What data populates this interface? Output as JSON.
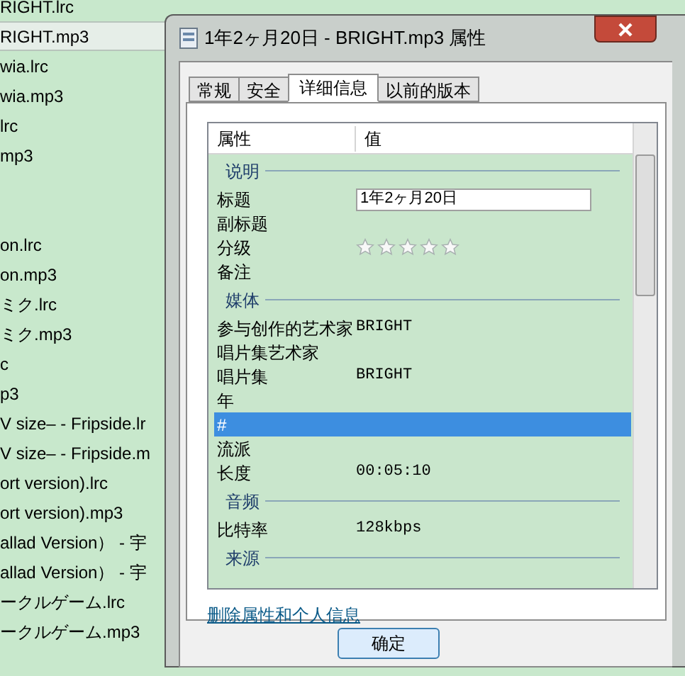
{
  "file_list": [
    {
      "name": "RIGHT.lrc",
      "selected": false
    },
    {
      "name": "RIGHT.mp3",
      "selected": true
    },
    {
      "name": "wia.lrc",
      "selected": false
    },
    {
      "name": "wia.mp3",
      "selected": false
    },
    {
      "name": "lrc",
      "selected": false
    },
    {
      "name": "mp3",
      "selected": false
    },
    {
      "selected": false
    },
    {
      "selected": false
    },
    {
      "name": "on.lrc",
      "selected": false
    },
    {
      "name": "on.mp3",
      "selected": false
    },
    {
      "name": "ミク.lrc",
      "selected": false
    },
    {
      "name": "ミク.mp3",
      "selected": false
    },
    {
      "name": "c",
      "selected": false
    },
    {
      "name": "p3",
      "selected": false
    },
    {
      "name": "V  size– - Fripside.lr",
      "selected": false
    },
    {
      "name": "V  size– - Fripside.m",
      "selected": false
    },
    {
      "name": "ort version).lrc",
      "selected": false
    },
    {
      "name": "ort version).mp3",
      "selected": false
    },
    {
      "name": "allad  Version） - 宇",
      "selected": false
    },
    {
      "name": "allad  Version） - 宇",
      "selected": false
    },
    {
      "name": "ークルゲーム.lrc",
      "selected": false
    },
    {
      "name": "ークルゲーム.mp3",
      "selected": false
    }
  ],
  "dialog": {
    "title": "1年2ヶ月20日 - BRIGHT.mp3 属性",
    "tabs": [
      {
        "label": "常规",
        "selected": false
      },
      {
        "label": "安全",
        "selected": false
      },
      {
        "label": "详细信息",
        "selected": true
      },
      {
        "label": "以前的版本",
        "selected": false
      }
    ],
    "columns": [
      "属性",
      "值"
    ],
    "groups": [
      {
        "heading": "说明",
        "rows": [
          {
            "kind": "input",
            "label": "标题",
            "value": "1年2ヶ月20日",
            "selected": false
          },
          {
            "kind": "text",
            "label": "副标题",
            "selected": false
          },
          {
            "kind": "rating",
            "label": "分级",
            "stars": 0,
            "selected": false
          },
          {
            "kind": "text",
            "label": "备注",
            "selected": false
          }
        ]
      },
      {
        "heading": "媒体",
        "rows": [
          {
            "kind": "text",
            "label": "参与创作的艺术家",
            "value": "BRIGHT",
            "selected": false
          },
          {
            "kind": "text",
            "label": "唱片集艺术家",
            "selected": false
          },
          {
            "kind": "text",
            "label": "唱片集",
            "value": "BRIGHT",
            "selected": false
          },
          {
            "kind": "text",
            "label": "年",
            "selected": false
          },
          {
            "kind": "text",
            "label": "#",
            "selected": true
          },
          {
            "kind": "text",
            "label": "流派",
            "selected": false
          },
          {
            "kind": "text",
            "label": "长度",
            "value": "00:05:10",
            "selected": false
          }
        ]
      },
      {
        "heading": "音频",
        "rows": [
          {
            "kind": "text",
            "label": "比特率",
            "value": "128kbps",
            "selected": false
          }
        ]
      },
      {
        "heading": "来源"
      }
    ],
    "link": "删除属性和个人信息",
    "buttons": [
      "确定"
    ]
  }
}
